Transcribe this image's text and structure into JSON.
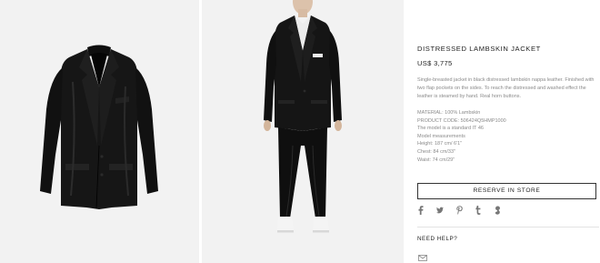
{
  "product": {
    "title": "DISTRESSED LAMBSKIN JACKET",
    "price": "US$ 3,775",
    "description": "Single-breasted jacket in black distressed lambskin nappa leather. Finished with two flap pockets on the sides. To reach the distressed and washed effect the leather is steamed by hand. Real horn buttons.",
    "specs": [
      "MATERIAL: 100% Lambskin",
      "PRODUCT CODE: 506424Q5HMP1000",
      "The model is a standard IT 46",
      "Model measurements",
      "Height: 187 cm/ 6'1\"",
      "Chest: 84 cm/33\"",
      "Waist: 74 cm/29\""
    ]
  },
  "actions": {
    "reserve_label": "RESERVE IN STORE"
  },
  "share": {
    "icons": [
      "facebook-icon",
      "twitter-icon",
      "pinterest-icon",
      "tumblr-icon",
      "google-plus-icon"
    ]
  },
  "help": {
    "label": "NEED HELP?"
  },
  "colors": {
    "background": "#ffffff",
    "image_panel": "#f2f2f2",
    "text": "#1e1e1e",
    "muted_text": "#8a8a8a",
    "garment": "#141414"
  }
}
